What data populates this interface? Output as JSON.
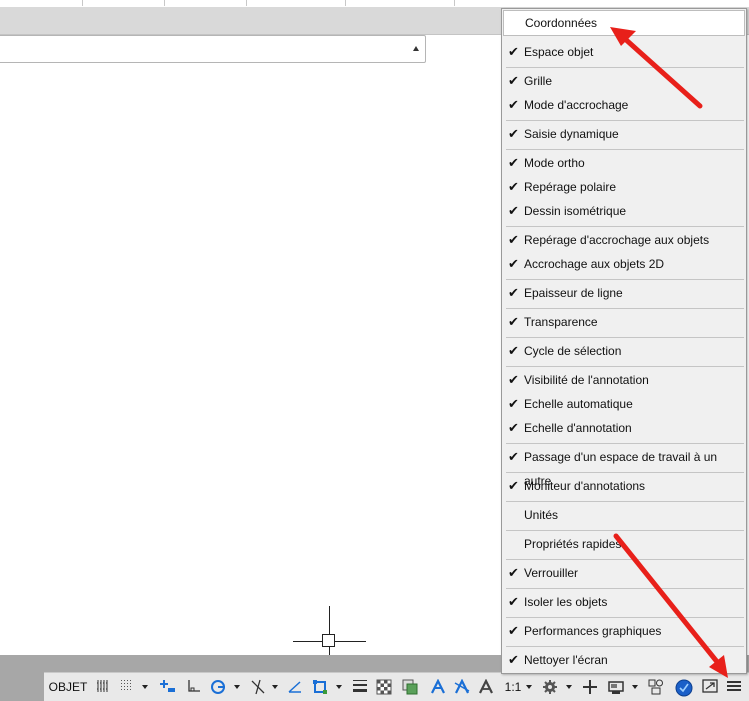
{
  "context_menu": {
    "items": [
      {
        "label": "Coordonnées",
        "checked": false,
        "highlighted": true
      },
      {
        "label": "Espace objet",
        "checked": true
      },
      {
        "label": "Grille",
        "checked": true
      },
      {
        "label": "Mode d'accrochage",
        "checked": true
      },
      {
        "label": "Saisie dynamique",
        "checked": true
      },
      {
        "label": "Mode ortho",
        "checked": true
      },
      {
        "label": "Repérage polaire",
        "checked": true
      },
      {
        "label": "Dessin isométrique",
        "checked": true
      },
      {
        "label": "Repérage d'accrochage aux objets",
        "checked": true
      },
      {
        "label": "Accrochage aux objets 2D",
        "checked": true
      },
      {
        "label": "Epaisseur de ligne",
        "checked": true
      },
      {
        "label": "Transparence",
        "checked": true
      },
      {
        "label": "Cycle de sélection",
        "checked": true
      },
      {
        "label": "Visibilité de l'annotation",
        "checked": true
      },
      {
        "label": "Echelle automatique",
        "checked": true
      },
      {
        "label": "Echelle d'annotation",
        "checked": true
      },
      {
        "label": "Passage d'un espace de travail à un autre",
        "checked": true
      },
      {
        "label": "Moniteur d'annotations",
        "checked": true
      },
      {
        "label": "Unités",
        "checked": false
      },
      {
        "label": "Propriétés rapides",
        "checked": false
      },
      {
        "label": "Verrouiller",
        "checked": true
      },
      {
        "label": "Isoler les objets",
        "checked": true
      },
      {
        "label": "Performances graphiques",
        "checked": true
      },
      {
        "label": "Nettoyer l'écran",
        "checked": true
      }
    ],
    "check_glyph": "✔"
  },
  "status_bar": {
    "model_label": "OBJET",
    "scale_label": "1:1",
    "icons": [
      "grid-icon",
      "snap-icon",
      "infer-icon",
      "ortho-icon",
      "polar-icon",
      "isodraft-icon",
      "object-snap-tracking-icon",
      "object-snap-icon",
      "lineweight-icon",
      "transparency-icon",
      "selection-cycling-icon",
      "annotation-visibility-icon",
      "autoscale-icon",
      "annotation-scale-icon",
      "workspace-gear-icon",
      "annotation-monitor-icon",
      "units-icon",
      "isolate-objects-icon",
      "hardware-acceleration-icon",
      "clean-screen-icon",
      "customization-menu-icon"
    ]
  },
  "colors": {
    "annotation_arrow": "#e8201a",
    "accent_blue": "#1a6fd6"
  }
}
